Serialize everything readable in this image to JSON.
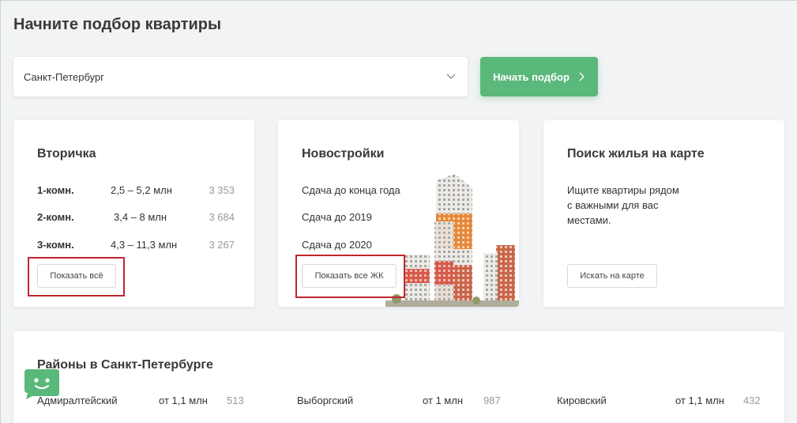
{
  "page": {
    "title": "Начните подбор квартиры"
  },
  "search": {
    "city_value": "Санкт-Петербург",
    "start_label": "Начать подбор"
  },
  "resale": {
    "title": "Вторичка",
    "rows": [
      {
        "rooms": "1-комн.",
        "price": "2,5 – 5,2 млн",
        "count": "3 353"
      },
      {
        "rooms": "2-комн.",
        "price": "3,4 – 8 млн",
        "count": "3 684"
      },
      {
        "rooms": "3-комн.",
        "price": "4,3 – 11,3 млн",
        "count": "3 267"
      }
    ],
    "button_label": "Показать всё"
  },
  "new_buildings": {
    "title": "Новостройки",
    "items": [
      "Сдача до конца года",
      "Сдача до 2019",
      "Сдача до 2020"
    ],
    "button_label": "Показать все ЖК"
  },
  "map_search": {
    "title": "Поиск жилья на карте",
    "description": "Ищите квартиры рядом с важными для вас местами.",
    "button_label": "Искать на карте"
  },
  "districts": {
    "title": "Районы в Санкт-Петербурге",
    "items": [
      {
        "name": "Адмиралтейский",
        "price": "от 1,1 млн",
        "count": "513"
      },
      {
        "name": "Выборгский",
        "price": "от 1 млн",
        "count": "987"
      },
      {
        "name": "Кировский",
        "price": "от 1,1 млн",
        "count": "432"
      }
    ]
  },
  "colors": {
    "accent_green": "#5ab87a",
    "highlight_red": "#c0272d",
    "building_orange": "#e5883a",
    "building_terracotta": "#c8654a"
  },
  "icons": {
    "select_chevron": "chevron-down-icon",
    "start_arrow": "chevron-right-icon",
    "chat": "chat-bot-icon"
  }
}
